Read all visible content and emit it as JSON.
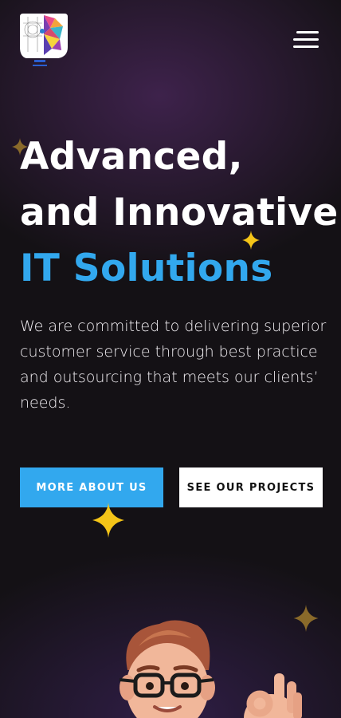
{
  "header": {
    "logo_icon": "robot-human-face-logo",
    "menu_icon": "hamburger-menu-icon"
  },
  "hero": {
    "title_line1": "Advanced,",
    "title_line2": "and Innovative",
    "title_line3": "IT Solutions",
    "description": "We are committed to delivering superior customer service through best practice and outsourcing that meets our clients’ needs.",
    "accent_color": "#32a8ee"
  },
  "buttons": {
    "primary_label": "MORE ABOUT US",
    "secondary_label": "SEE OUR PROJECTS"
  },
  "decorations": {
    "sparkle_color": "#f5c518",
    "illustration": "3d-cartoon-man-with-glasses-ok-gesture"
  }
}
